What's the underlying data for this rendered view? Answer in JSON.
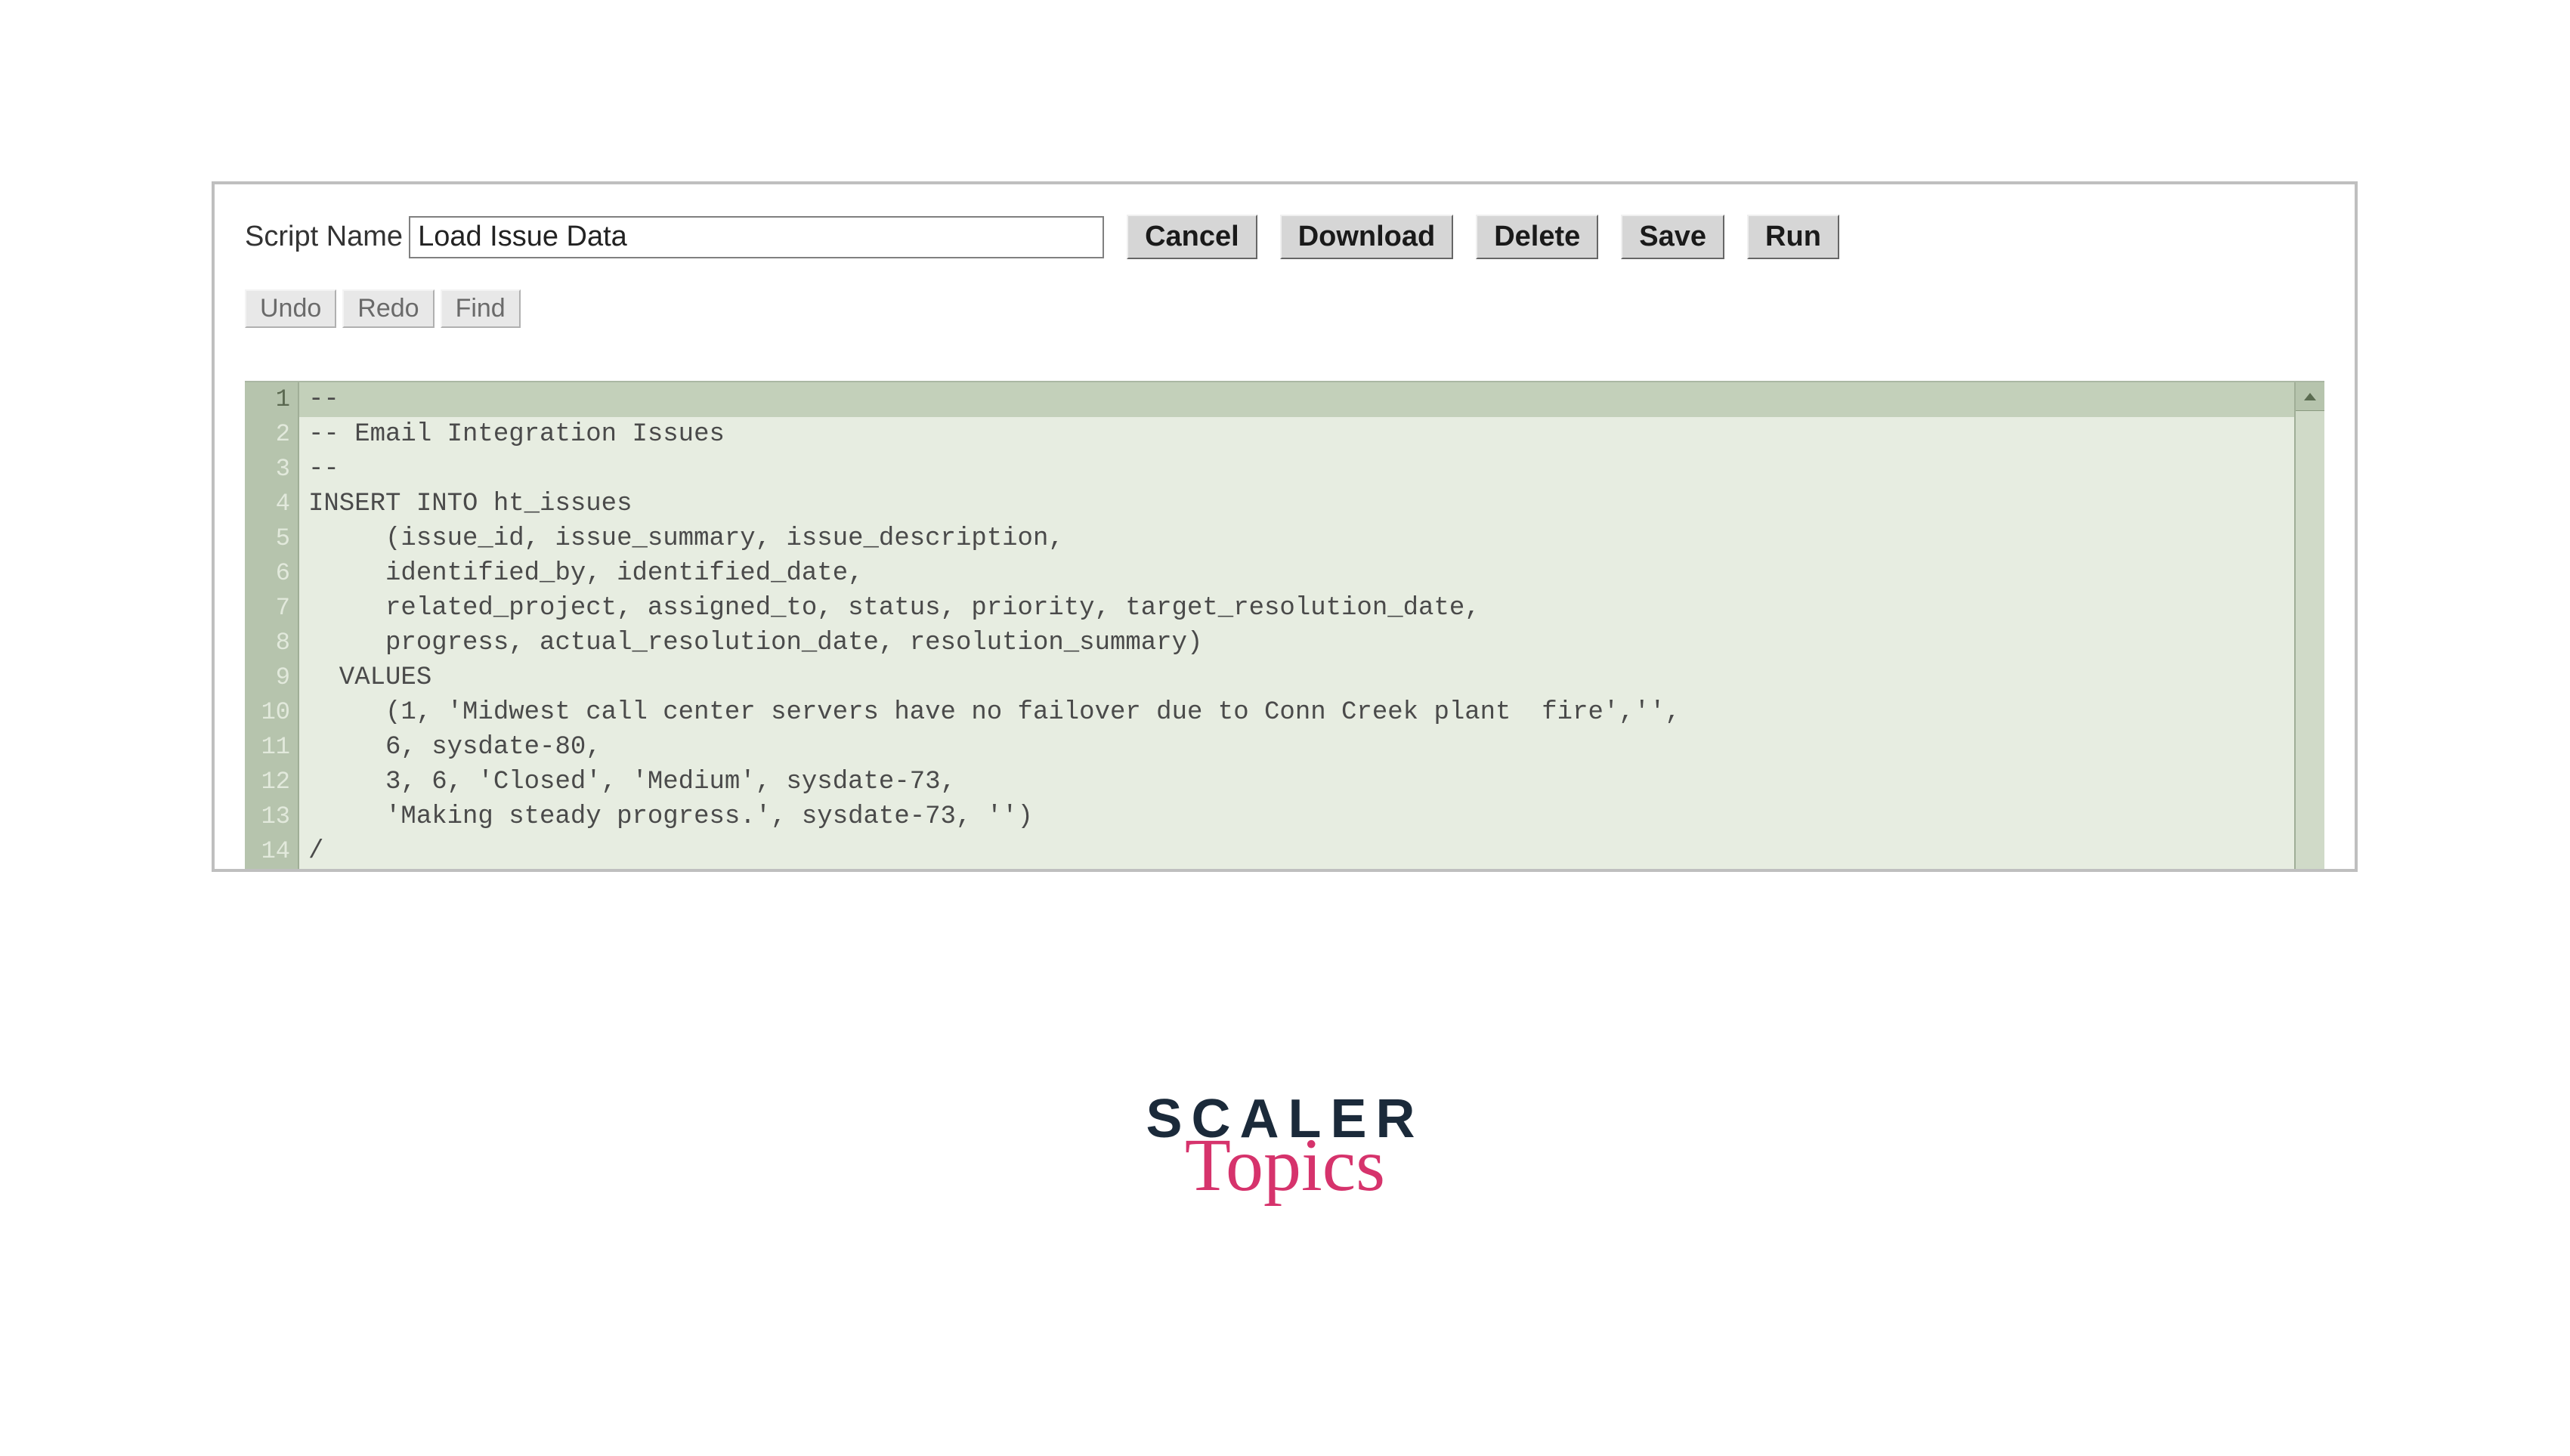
{
  "header": {
    "script_name_label": "Script Name",
    "script_name_value": "Load Issue Data",
    "buttons": {
      "cancel": "Cancel",
      "download": "Download",
      "delete": "Delete",
      "save": "Save",
      "run": "Run"
    },
    "util": {
      "undo": "Undo",
      "redo": "Redo",
      "find": "Find"
    }
  },
  "editor": {
    "active_line": 1,
    "lines": [
      "--",
      "-- Email Integration Issues",
      "--",
      "INSERT INTO ht_issues",
      "     (issue_id, issue_summary, issue_description,",
      "     identified_by, identified_date,",
      "     related_project, assigned_to, status, priority, target_resolution_date,",
      "     progress, actual_resolution_date, resolution_summary)",
      "  VALUES",
      "     (1, 'Midwest call center servers have no failover due to Conn Creek plant  fire','',",
      "     6, sysdate-80,",
      "     3, 6, 'Closed', 'Medium', sysdate-73,",
      "     'Making steady progress.', sysdate-73, '')",
      "/"
    ],
    "line_numbers": [
      "1",
      "2",
      "3",
      "4",
      "5",
      "6",
      "7",
      "8",
      "9",
      "10",
      "11",
      "12",
      "13",
      "14"
    ]
  },
  "branding": {
    "scaler": "SCALER",
    "topics": "Topics"
  }
}
